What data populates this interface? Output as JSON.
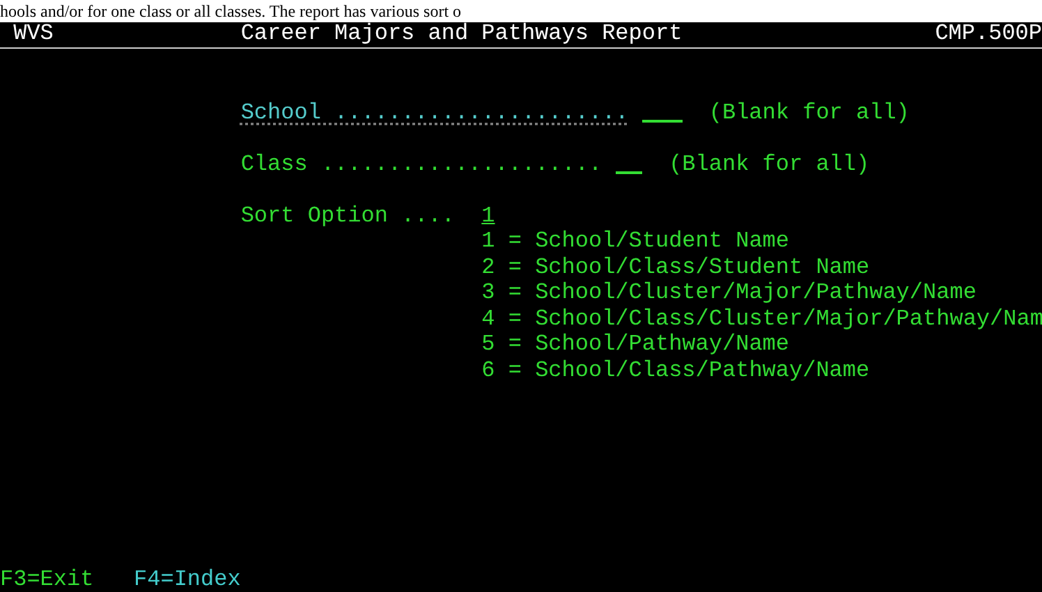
{
  "document_text": "hools and/or for one class or all classes.  The report has various sort o",
  "terminal": {
    "system": "WVS",
    "title": "Career Majors and Pathways Report",
    "program": "CMP.500P",
    "fields": [
      {
        "label": "School ......................",
        "hint": "(Blank for all)",
        "selected": true
      },
      {
        "label": "Class .....................",
        "hint": "(Blank for all)",
        "selected": false
      }
    ],
    "sort": {
      "label": "Sort Option ....",
      "value": "1",
      "options": [
        "1 = School/Student Name",
        "2 = School/Class/Student Name",
        "3 = School/Cluster/Major/Pathway/Name",
        "4 = School/Class/Cluster/Major/Pathway/Nam",
        "5 = School/Pathway/Name",
        "6 = School/Class/Pathway/Name"
      ]
    },
    "function_keys": [
      {
        "label": "F3=Exit",
        "color": "#33dd33"
      },
      {
        "label": "F4=Index",
        "color": "#44cccc"
      }
    ]
  }
}
